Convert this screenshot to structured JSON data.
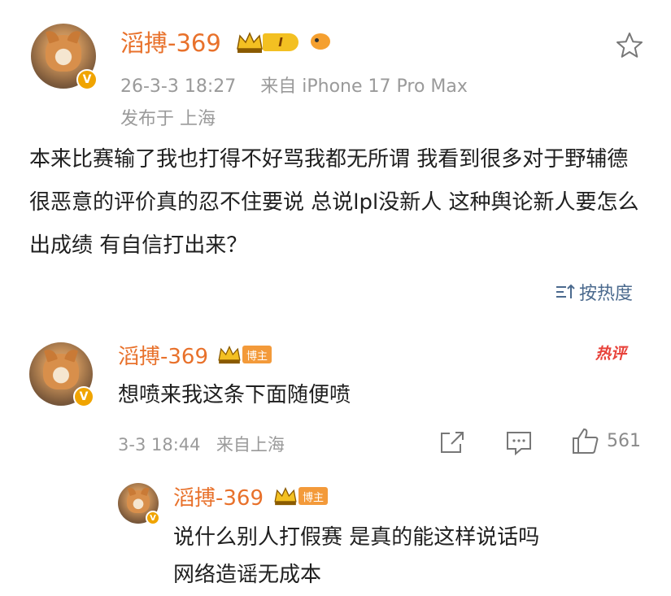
{
  "post": {
    "author": "滔搏-369",
    "level_badge": "I",
    "timestamp": "26-3-3 18:27",
    "source": "来自 iPhone 17 Pro Max",
    "location": "发布于 上海",
    "body": "本来比赛输了我也打得不好骂我都无所谓  我看到很多对于野辅德很恶意的评价真的忍不住要说 总说lpl没新人 这种舆论新人要怎么出成绩 有自信打出来？"
  },
  "sort": {
    "label": "按热度",
    "icon": "sort-icon"
  },
  "comments": [
    {
      "author": "滔搏-369",
      "badge": "博主",
      "hot_label": "热评",
      "text": "想喷来我这条下面随便喷",
      "time": "3-3 18:44",
      "location": "来自上海",
      "like_count": "561"
    }
  ],
  "reply": {
    "author": "滔搏-369",
    "badge": "博主",
    "text_line1": "说什么别人打假赛  是真的能这样说话吗",
    "text_line2": "网络造谣无成本"
  },
  "colors": {
    "accent_name": "#e8712b",
    "meta_gray": "#9a9a9a",
    "link_blue": "#4b6a8e",
    "hot_red": "#e8433b"
  }
}
